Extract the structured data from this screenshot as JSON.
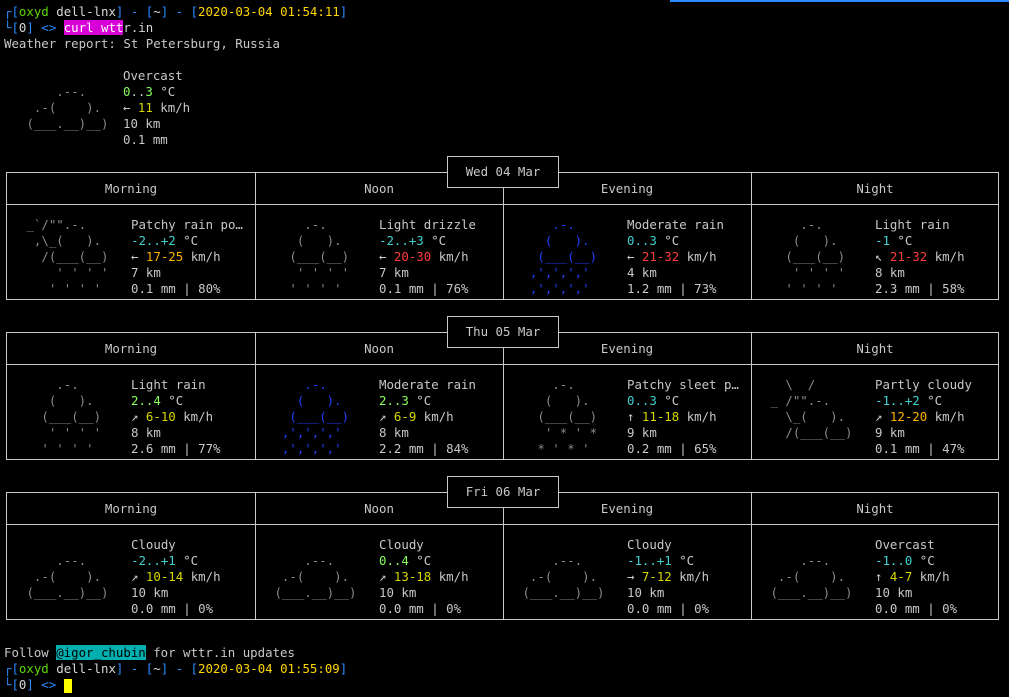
{
  "prompt1": {
    "user": "oxyd",
    "host": "dell-lnx",
    "dir": "~",
    "time": "2020-03-04 01:54:11",
    "status": "0"
  },
  "command": {
    "hl": "curl wtt",
    "rest": "r.in"
  },
  "report_title": "Weather report: St Petersburg, Russia",
  "current": {
    "art": "     .--.\n  .-(    ).\n (___.__)__)",
    "cond": "Overcast",
    "temp_a": "0",
    "temp_b": "..",
    "temp_c": "3",
    "temp_unit": " °C",
    "wind_dir": "← ",
    "wind_val": "11",
    "wind_unit": " km/h",
    "vis": "10 km",
    "precip": "0.1 mm"
  },
  "days": [
    {
      "label": "Wed 04 Mar",
      "periods": [
        {
          "name": "Morning",
          "art": " _`/\"\".-.\n  ,\\_(   ).\n   /(___(__)\n     ' ' ' '\n    ' ' ' '",
          "cond": "Patchy rain po…",
          "temp": "-2..+2",
          "temp_color": "c-cyan",
          "wind_dir": "← ",
          "wind": "17-25",
          "wind_color": "c-orange",
          "vis": "7 km",
          "precip": "0.1 mm | 80%"
        },
        {
          "name": "Noon",
          "art": "     .-.\n    (   ).\n   (___(__)\n    ' ' ' '\n   ' ' ' '",
          "cond": "Light drizzle",
          "temp": "-2..+3",
          "temp_color": "c-cyan",
          "wind_dir": "← ",
          "wind": "20-30",
          "wind_color": "c-red",
          "vis": "7 km",
          "precip": "0.1 mm | 76%"
        },
        {
          "name": "Evening",
          "art": "     .-.\n    (   ).\n   (___(__)\n  ‚'‚'‚'‚'\n  ‚'‚'‚'‚'",
          "art_color": "c-blue",
          "cond": "Moderate rain",
          "temp": "0..3",
          "temp_color": "c-cyan",
          "wind_dir": "← ",
          "wind": "21-32",
          "wind_color": "c-red",
          "vis": "4 km",
          "precip": "1.2 mm | 73%"
        },
        {
          "name": "Night",
          "art": "     .-.\n    (   ).\n   (___(__)\n    ' ' ' '\n   ' ' ' '",
          "cond": "Light rain",
          "temp": "-1",
          "temp_color": "c-cyan",
          "wind_dir": "↖ ",
          "wind": "21-32",
          "wind_color": "c-red",
          "vis": "8 km",
          "precip": "2.3 mm | 58%"
        }
      ]
    },
    {
      "label": "Thu 05 Mar",
      "periods": [
        {
          "name": "Morning",
          "art": "     .-.\n    (   ).\n   (___(__)\n    ' ' ' '\n   ' ' ' '",
          "cond": "Light rain",
          "temp": "2..4",
          "temp_color": "c-green",
          "wind_dir": "↗ ",
          "wind": "6-10",
          "wind_color": "c-yellow",
          "vis": "8 km",
          "precip": "2.6 mm | 77%"
        },
        {
          "name": "Noon",
          "art": "     .-.\n    (   ).\n   (___(__)\n  ‚'‚'‚'‚'\n  ‚'‚'‚'‚'",
          "art_color": "c-blue",
          "cond": "Moderate rain",
          "temp": "2..3",
          "temp_color": "c-green",
          "wind_dir": "↗ ",
          "wind": "6-9",
          "wind_color": "c-yellow",
          "vis": "8 km",
          "precip": "2.2 mm | 84%"
        },
        {
          "name": "Evening",
          "art": "     .-.\n    (   ).\n   (___(__)\n    ' * ' *\n   * ' * '",
          "cond": "Patchy sleet p…",
          "temp": "0..3",
          "temp_color": "c-cyan",
          "wind_dir": "↑ ",
          "wind": "11-18",
          "wind_color": "c-yellow",
          "vis": "9 km",
          "precip": "0.2 mm | 65%"
        },
        {
          "name": "Night",
          "art": "   \\  /\n _ /\"\".-.\n   \\_(   ).\n   /(___(__)",
          "cond": "Partly cloudy",
          "temp": "-1..+2",
          "temp_color": "c-cyan",
          "wind_dir": "↗ ",
          "wind": "12-20",
          "wind_color": "c-orange",
          "vis": "9 km",
          "precip": "0.1 mm | 47%"
        }
      ]
    },
    {
      "label": "Fri 06 Mar",
      "periods": [
        {
          "name": "Morning",
          "art": "\n     .--.\n  .-(    ).\n (___.__)__)",
          "cond": "Cloudy",
          "temp": "-2..+1",
          "temp_color": "c-cyan",
          "wind_dir": "↗ ",
          "wind": "10-14",
          "wind_color": "c-yellow",
          "vis": "10 km",
          "precip": "0.0 mm | 0%"
        },
        {
          "name": "Noon",
          "art": "\n     .--.\n  .-(    ).\n (___.__)__)",
          "cond": "Cloudy",
          "temp": "0..4",
          "temp_color": "c-green",
          "wind_dir": "↗ ",
          "wind": "13-18",
          "wind_color": "c-yellow",
          "vis": "10 km",
          "precip": "0.0 mm | 0%"
        },
        {
          "name": "Evening",
          "art": "\n     .--.\n  .-(    ).\n (___.__)__)",
          "cond": "Cloudy",
          "temp": "-1..+1",
          "temp_color": "c-cyan",
          "wind_dir": "→ ",
          "wind": "7-12",
          "wind_color": "c-yellow",
          "vis": "10 km",
          "precip": "0.0 mm | 0%"
        },
        {
          "name": "Night",
          "art": "\n     .--.\n  .-(    ).\n (___.__)__)",
          "cond": "Overcast",
          "temp": "-1..0",
          "temp_color": "c-cyan",
          "wind_dir": "↑ ",
          "wind": "4-7",
          "wind_color": "c-yellow",
          "vis": "10 km",
          "precip": "0.0 mm | 0%"
        }
      ]
    }
  ],
  "follow": {
    "pre": "Follow ",
    "handle": "@igor_chubin",
    "post": " for wttr.in updates"
  },
  "prompt2": {
    "user": "oxyd",
    "host": "dell-lnx",
    "dir": "~",
    "time": "2020-03-04 01:55:09",
    "status": "0"
  },
  "temp_unit": " °C",
  "wind_unit": " km/h",
  "colors": {
    "prompt_blue": "#2c8cff",
    "prompt_green": "#5fd700",
    "command_highlight": "#d700d7",
    "handle_highlight": "#00afaf",
    "cursor": "#ffff00"
  }
}
